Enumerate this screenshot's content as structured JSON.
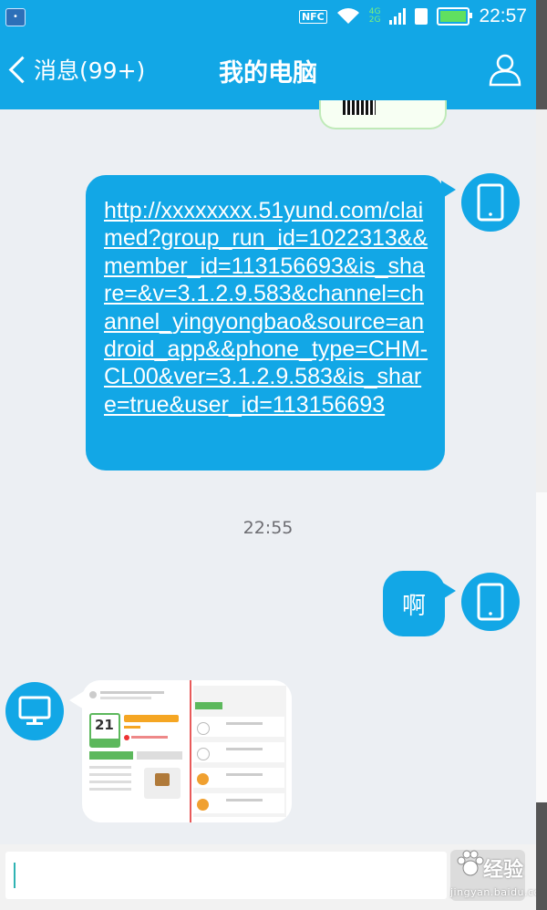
{
  "status_bar": {
    "nfc": "NFC",
    "network_top": "4G",
    "network_bottom": "2G",
    "time": "22:57"
  },
  "header": {
    "back_label": "消息(99+)",
    "title": "我的电脑"
  },
  "messages": [
    {
      "type": "link",
      "direction": "outgoing",
      "sender_icon": "phone-icon",
      "text": "http://xxxxxxxx.51yund.com/claimed?group_run_id=1022313&&member_id=113156693&is_share=&v=3.1.2.9.583&channel=channel_yingyongbao&source=android_app&&phone_type=CHM-CL00&ver=3.1.2.9.583&is_share=true&user_id=113156693"
    },
    {
      "type": "timestamp",
      "text": "22:55"
    },
    {
      "type": "text",
      "direction": "outgoing",
      "sender_icon": "phone-icon",
      "text": "啊"
    },
    {
      "type": "image",
      "direction": "incoming",
      "sender_icon": "computer-icon",
      "thumbnail": {
        "day_number": "21"
      }
    }
  ],
  "input": {
    "placeholder": ""
  },
  "watermark": {
    "brand": "经验",
    "url": "jingyan.baidu.com"
  },
  "colors": {
    "accent": "#12a7e6",
    "background": "#eceff3"
  }
}
